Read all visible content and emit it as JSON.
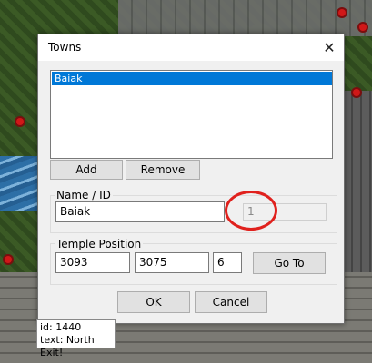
{
  "dialog": {
    "title": "Towns",
    "close_glyph": "✕"
  },
  "towns_list": {
    "items": [
      "Baiak"
    ],
    "selected_index": 0
  },
  "buttons": {
    "add": "Add",
    "remove": "Remove",
    "goto": "Go To",
    "ok": "OK",
    "cancel": "Cancel"
  },
  "name_group": {
    "label": "Name / ID",
    "name_value": "Baiak",
    "id_value": "1",
    "id_disabled": true
  },
  "temple_group": {
    "label": "Temple Position",
    "x": "3093",
    "y": "3075",
    "z": "6"
  },
  "tooltip": {
    "line1": "id: 1440",
    "line2": "text: North Exit!"
  },
  "colors": {
    "selection": "#0078d7",
    "annotation": "#e0211d"
  },
  "icons": {
    "close": "close-icon"
  }
}
